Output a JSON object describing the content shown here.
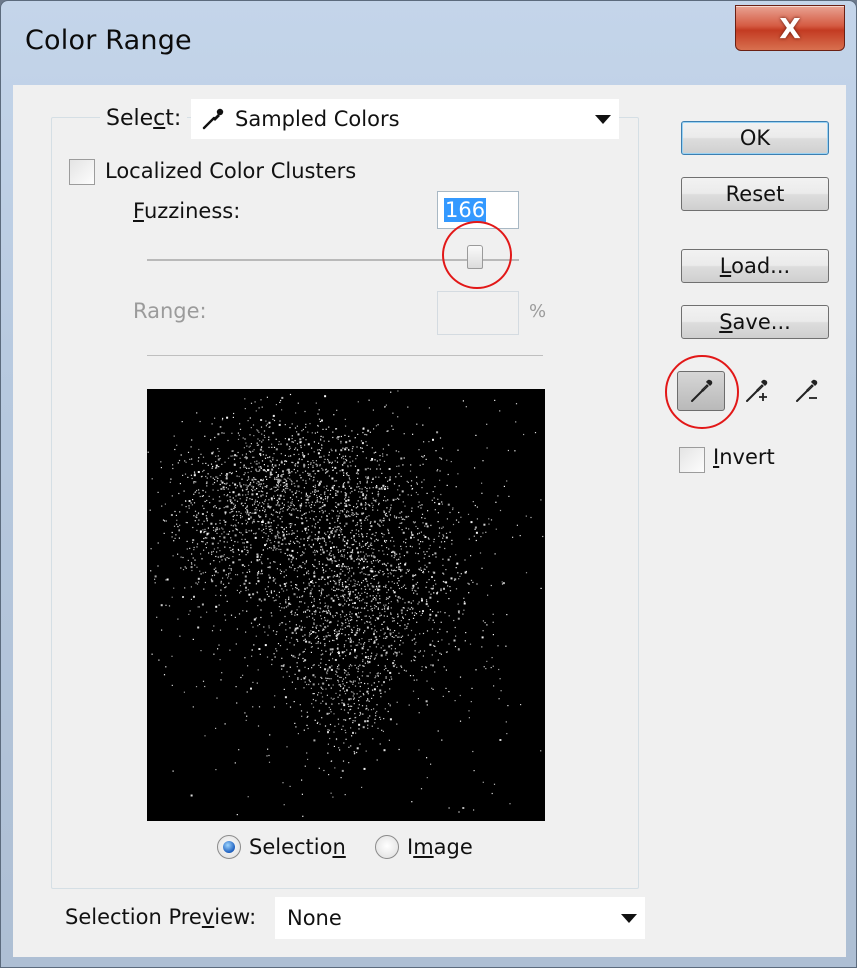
{
  "window": {
    "title": "Color Range",
    "close_glyph": "X"
  },
  "select": {
    "label_pre": "Sele",
    "label_mnemonic": "c",
    "label_post": "t:",
    "value": "Sampled Colors",
    "icon": "eyedropper-icon"
  },
  "localized_clusters": {
    "label": "Localized Color Clusters",
    "checked": false
  },
  "fuzziness": {
    "label_mnemonic": "F",
    "label_rest": "uzziness:",
    "value": "166"
  },
  "range": {
    "label": "Range:",
    "value": "",
    "unit": "%"
  },
  "preview_mode": {
    "selection_pre": "Selectio",
    "selection_mnemonic": "n",
    "image_pre": "I",
    "image_mnemonic": "m",
    "image_post": "age",
    "selected": "Selection"
  },
  "buttons": {
    "ok": "OK",
    "reset": "Reset",
    "load_mnemonic": "L",
    "load_rest": "oad...",
    "save_mnemonic": "S",
    "save_rest": "ave..."
  },
  "tools": [
    "eyedropper-icon",
    "eyedropper-plus-icon",
    "eyedropper-minus-icon"
  ],
  "invert": {
    "label_mnemonic": "I",
    "label_rest": "nvert",
    "checked": false
  },
  "selection_preview": {
    "label_pre": "Selection Pre",
    "label_mnemonic": "v",
    "label_post": "iew:",
    "value": "None"
  },
  "colors": {
    "annotation": "#e21818",
    "selection_highlight": "#3399ff"
  }
}
